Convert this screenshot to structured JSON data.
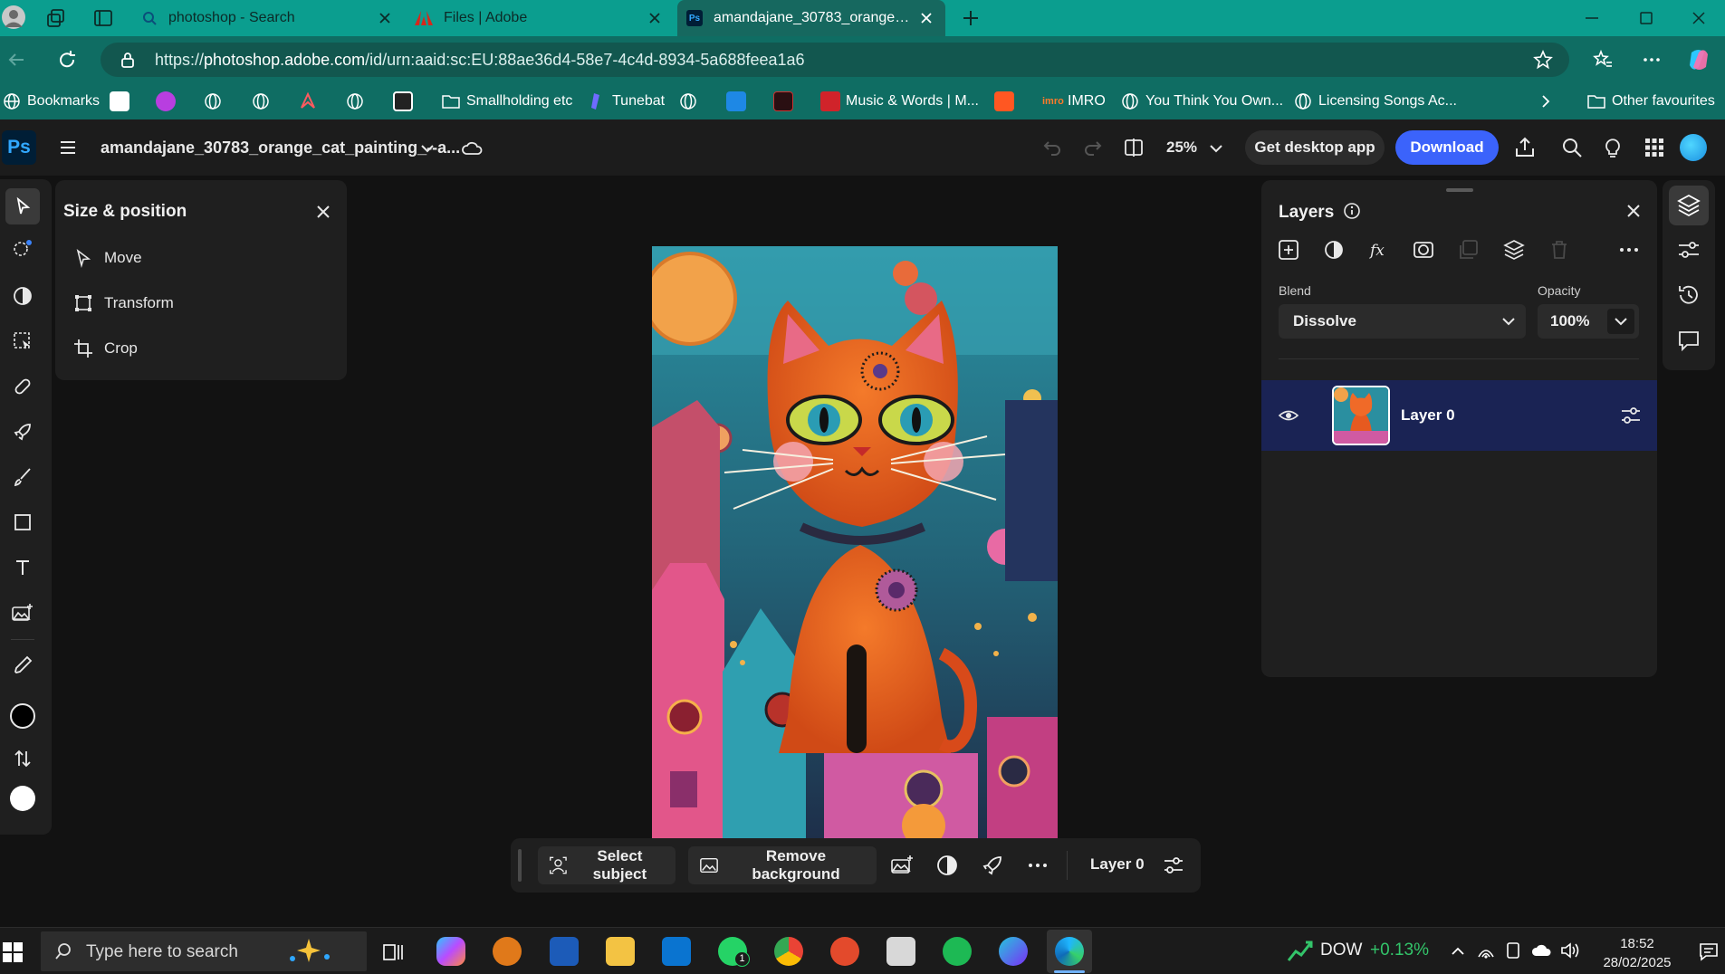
{
  "browser": {
    "tabs": [
      {
        "title": "photoshop - Search",
        "active": false
      },
      {
        "title": "Files | Adobe",
        "active": false
      },
      {
        "title": "amandajane_30783_orange_cat_p",
        "active": true
      }
    ],
    "url_prefix": "https://",
    "url_domain": "photoshop.adobe.com",
    "url_path": "/id/urn:aaid:sc:EU:88ae36d4-58e7-4c4d-8934-5a688feea1a6"
  },
  "bookmarks": {
    "bookmarks_label": "Bookmarks",
    "items": [
      {
        "label": "Smallholding etc",
        "icon": "folder-icon"
      },
      {
        "label": "Tunebat",
        "icon": "tunebat-icon"
      },
      {
        "label": "Music & Words | M...",
        "icon": "music-words-icon"
      },
      {
        "label": "IMRO",
        "icon": "imro-icon"
      },
      {
        "label": "You Think You Own...",
        "icon": "globe-icon"
      },
      {
        "label": "Licensing Songs Ac...",
        "icon": "globe-icon"
      }
    ],
    "other_favourites": "Other favourites"
  },
  "ps_header": {
    "app_badge": "Ps",
    "document_title": "amandajane_30783_orange_cat_painting_--a...",
    "zoom": "25%",
    "get_desktop_app": "Get desktop app",
    "download": "Download"
  },
  "size_panel": {
    "title": "Size & position",
    "items": [
      "Move",
      "Transform",
      "Crop"
    ]
  },
  "layers_panel": {
    "title": "Layers",
    "blend_label": "Blend",
    "blend_value": "Dissolve",
    "opacity_label": "Opacity",
    "opacity_value": "100%",
    "layers": [
      {
        "name": "Layer 0",
        "visible": true,
        "selected": true
      }
    ]
  },
  "context_bar": {
    "select_subject": "Select subject",
    "remove_background": "Remove background",
    "layer_name": "Layer 0"
  },
  "taskbar": {
    "search_placeholder": "Type here to search",
    "ticker": "DOW",
    "ticker_change": "+0.13%",
    "time": "18:52",
    "date": "28/02/2025",
    "whatsapp_badge": "1"
  },
  "colors": {
    "accent": "#3b63fb",
    "browser_chrome": "#0b9e8f",
    "selected_layer": "#1a2354",
    "ticker_positive": "#33c46a"
  }
}
